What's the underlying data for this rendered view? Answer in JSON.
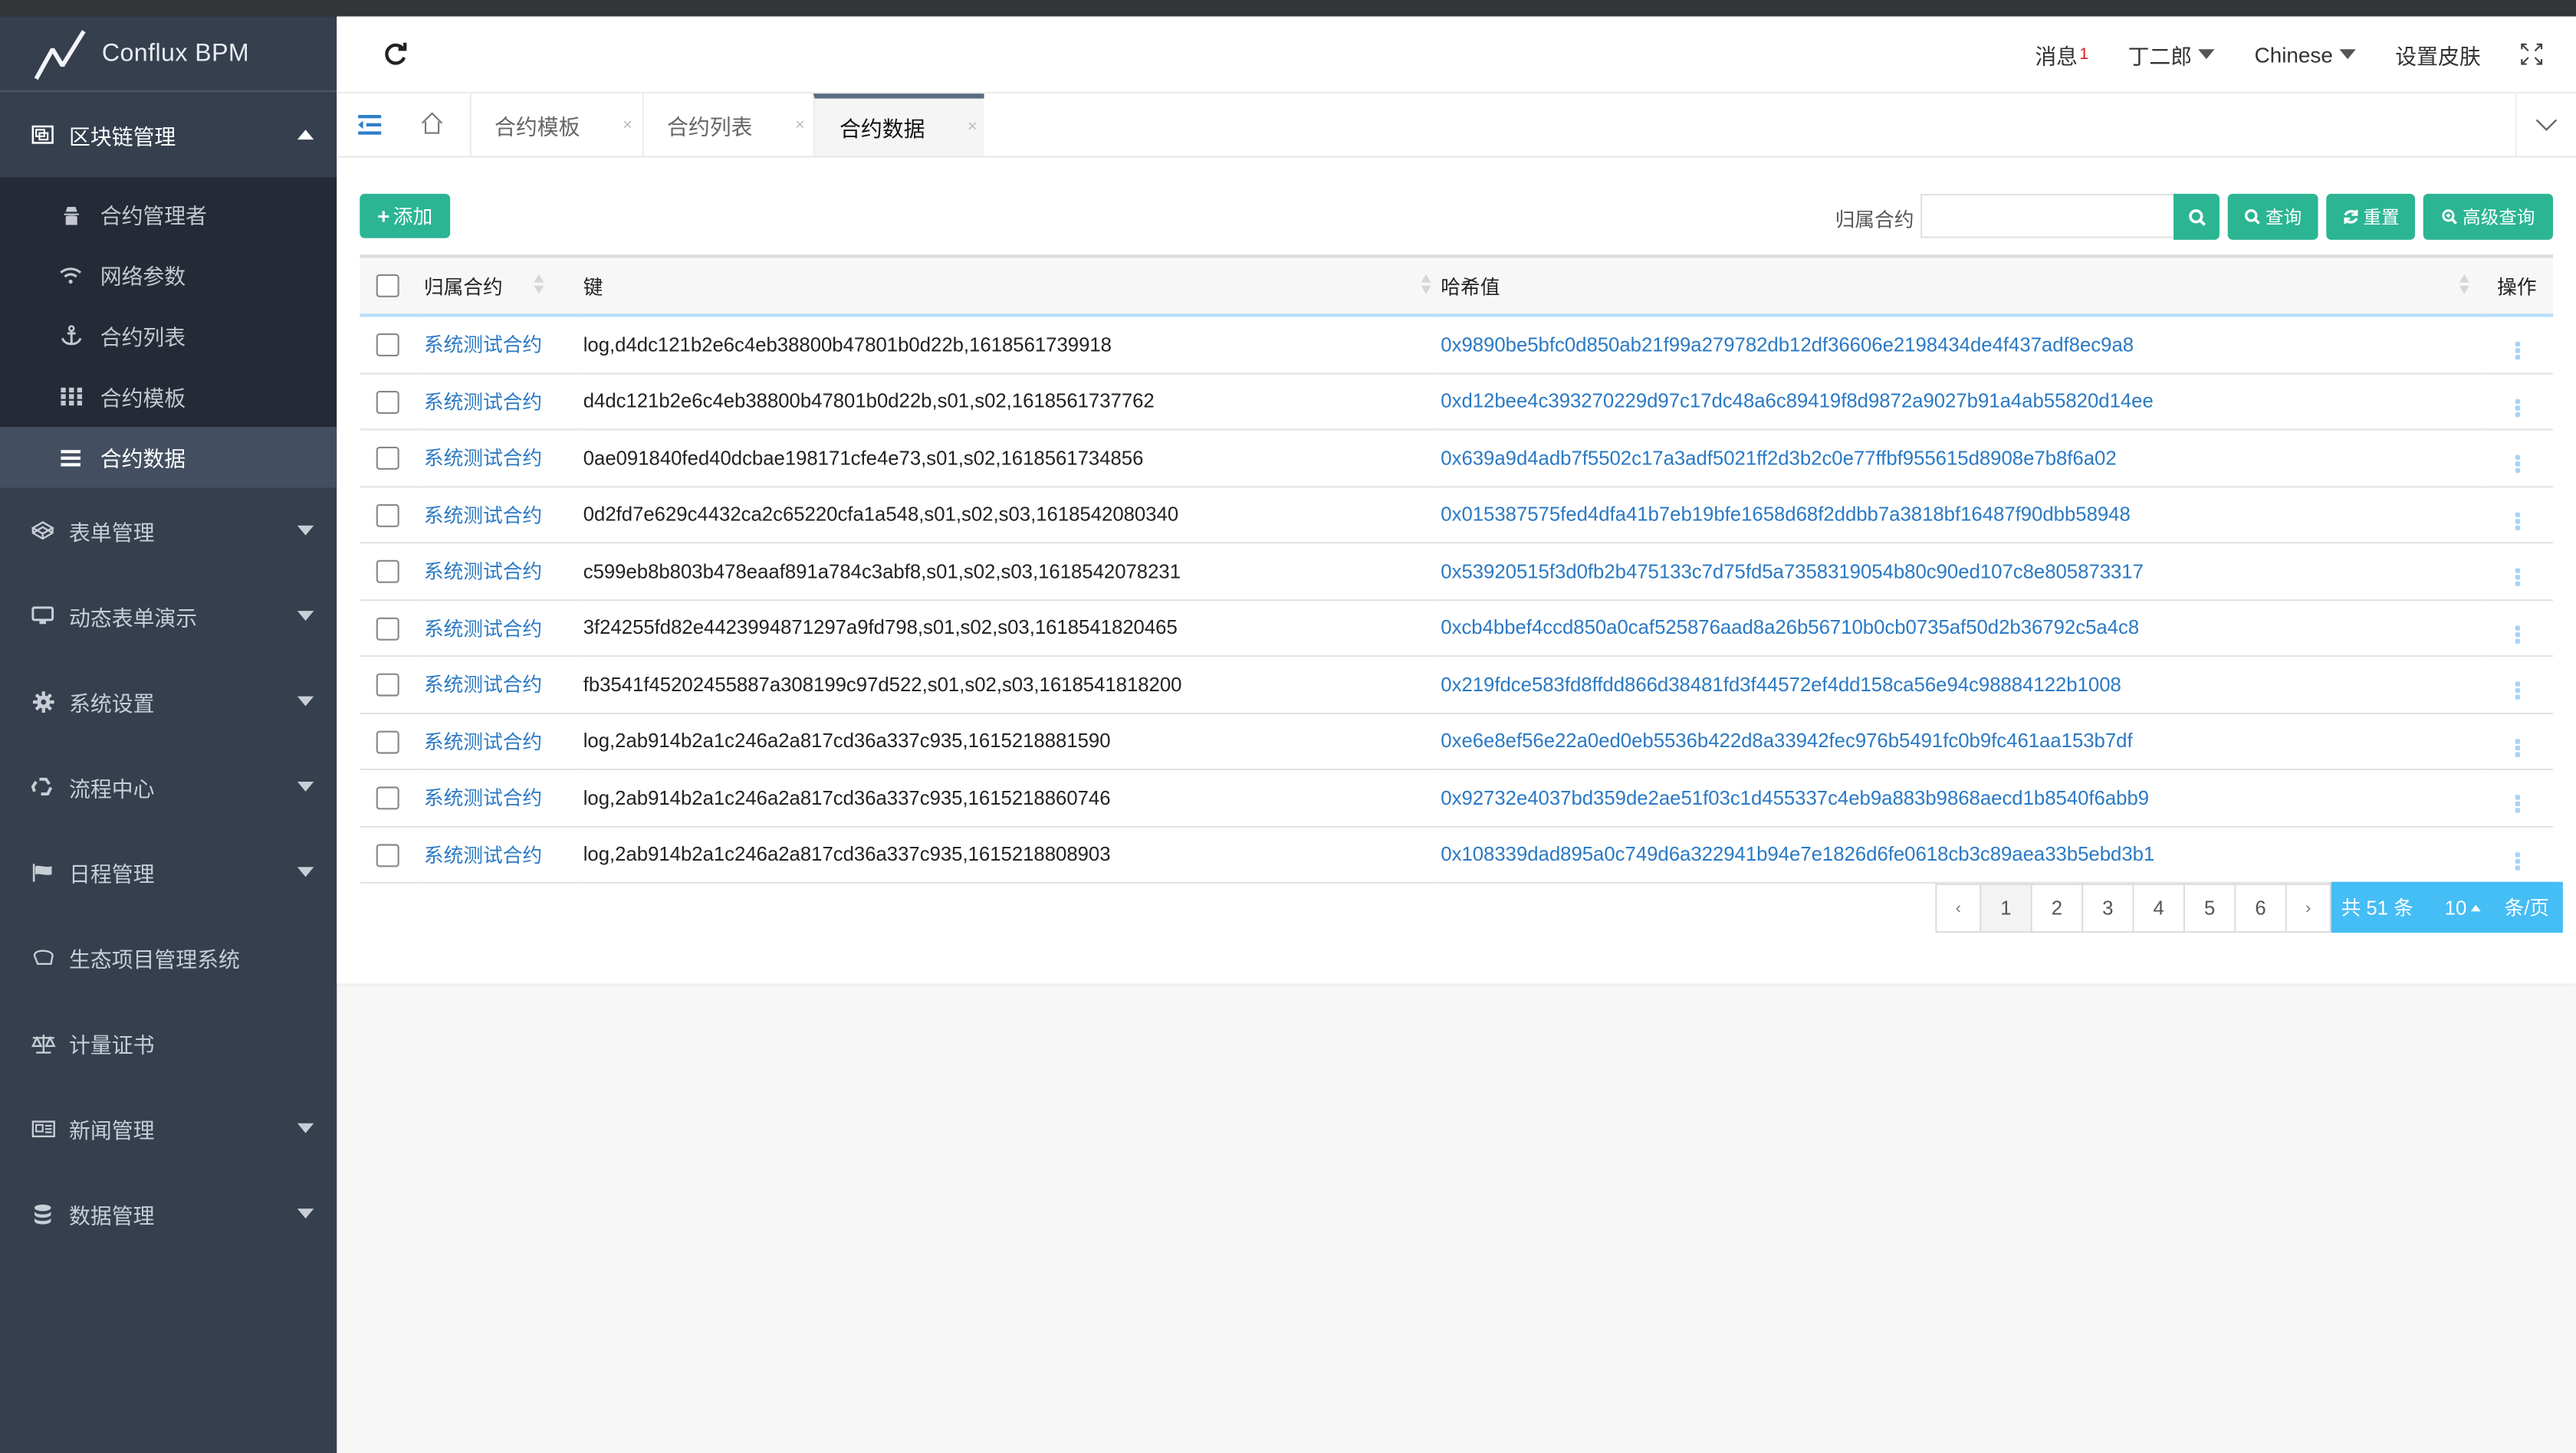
{
  "app": {
    "brand": "Conflux BPM"
  },
  "sidebar": {
    "groups": [
      {
        "label": "区块链管理",
        "icon": "blockchain-icon",
        "expanded": true,
        "items": [
          {
            "label": "合约管理者",
            "icon": "user-secret-icon"
          },
          {
            "label": "网络参数",
            "icon": "wifi-icon"
          },
          {
            "label": "合约列表",
            "icon": "anchor-icon"
          },
          {
            "label": "合约模板",
            "icon": "grid-icon"
          },
          {
            "label": "合约数据",
            "icon": "list-icon",
            "active": true
          }
        ]
      },
      {
        "label": "表单管理",
        "icon": "codepen-icon",
        "has_children": true
      },
      {
        "label": "动态表单演示",
        "icon": "desktop-icon",
        "has_children": true
      },
      {
        "label": "系统设置",
        "icon": "gear-icon",
        "has_children": true
      },
      {
        "label": "流程中心",
        "icon": "recycle-icon",
        "has_children": true
      },
      {
        "label": "日程管理",
        "icon": "flag-icon",
        "has_children": true
      },
      {
        "label": "生态项目管理系统",
        "icon": "hand-icon",
        "has_children": false
      },
      {
        "label": "计量证书",
        "icon": "balance-scale-icon",
        "has_children": false
      },
      {
        "label": "新闻管理",
        "icon": "newspaper-icon",
        "has_children": true
      },
      {
        "label": "数据管理",
        "icon": "database-icon",
        "has_children": true
      }
    ]
  },
  "header": {
    "messages_label": "消息",
    "messages_count": "1",
    "user": "丁二郎",
    "language": "Chinese",
    "skin": "设置皮肤"
  },
  "tabs": [
    {
      "label": "合约模板",
      "close": "×"
    },
    {
      "label": "合约列表",
      "close": "×"
    },
    {
      "label": "合约数据",
      "close": "×",
      "active": true
    }
  ],
  "toolbar": {
    "add_label": "添加",
    "search_label": "归属合约",
    "search_value": "",
    "search_placeholder": "",
    "query_label": "查询",
    "reset_label": "重置",
    "advanced_label": "高级查询"
  },
  "table": {
    "columns": [
      "归属合约",
      "键",
      "哈希值",
      "操作"
    ],
    "rows": [
      {
        "contract": "系统测试合约",
        "key": "log,d4dc121b2e6c4eb38800b47801b0d22b,1618561739918",
        "hash": "0x9890be5bfc0d850ab21f99a279782db12df36606e2198434de4f437adf8ec9a8"
      },
      {
        "contract": "系统测试合约",
        "key": "d4dc121b2e6c4eb38800b47801b0d22b,s01,s02,1618561737762",
        "hash": "0xd12bee4c393270229d97c17dc48a6c89419f8d9872a9027b91a4ab55820d14ee"
      },
      {
        "contract": "系统测试合约",
        "key": "0ae091840fed40dcbae198171cfe4e73,s01,s02,1618561734856",
        "hash": "0x639a9d4adb7f5502c17a3adf5021ff2d3b2c0e77ffbf955615d8908e7b8f6a02"
      },
      {
        "contract": "系统测试合约",
        "key": "0d2fd7e629c4432ca2c65220cfa1a548,s01,s02,s03,1618542080340",
        "hash": "0x015387575fed4dfa41b7eb19bfe1658d68f2ddbb7a3818bf16487f90dbb58948"
      },
      {
        "contract": "系统测试合约",
        "key": "c599eb8b803b478eaaf891a784c3abf8,s01,s02,s03,1618542078231",
        "hash": "0x53920515f3d0fb2b475133c7d75fd5a7358319054b80c90ed107c8e805873317"
      },
      {
        "contract": "系统测试合约",
        "key": "3f24255fd82e4423994871297a9fd798,s01,s02,s03,1618541820465",
        "hash": "0xcb4bbef4ccd850a0caf525876aad8a26b56710b0cb0735af50d2b36792c5a4c8"
      },
      {
        "contract": "系统测试合约",
        "key": "fb3541f45202455887a308199c97d522,s01,s02,s03,1618541818200",
        "hash": "0x219fdce583fd8ffdd866d38481fd3f44572ef4dd158ca56e94c98884122b1008"
      },
      {
        "contract": "系统测试合约",
        "key": "log,2ab914b2a1c246a2a817cd36a337c935,1615218881590",
        "hash": "0xe6e8ef56e22a0ed0eb5536b422d8a33942fec976b5491fc0b9fc461aa153b7df"
      },
      {
        "contract": "系统测试合约",
        "key": "log,2ab914b2a1c246a2a817cd36a337c935,1615218860746",
        "hash": "0x92732e4037bd359de2ae51f03c1d455337c4eb9a883b9868aecd1b8540f6abb9"
      },
      {
        "contract": "系统测试合约",
        "key": "log,2ab914b2a1c246a2a817cd36a337c935,1615218808903",
        "hash": "0x108339dad895a0c749d6a322941b94e7e1826d6fe0618cb3c89aea33b5ebd3b1"
      }
    ]
  },
  "pagination": {
    "prev": "‹",
    "next": "›",
    "pages": [
      "1",
      "2",
      "3",
      "4",
      "5",
      "6"
    ],
    "current": "1",
    "total_label": "共 51 条",
    "page_size": "10",
    "page_size_unit": "条/页"
  },
  "colors": {
    "accent": "#2bb593",
    "link": "#2a79c4",
    "sidebar_bg": "#353f4e",
    "submenu_bg": "#252b36",
    "active_item_bg": "#434f60",
    "pager_info_bg": "#45bdf5",
    "badge": "#e01b1b"
  }
}
